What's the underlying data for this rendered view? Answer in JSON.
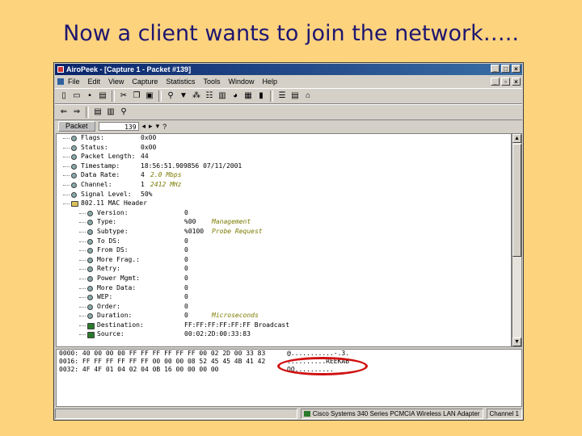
{
  "slide": {
    "title": "Now a client wants to join the network….."
  },
  "window": {
    "title": "AiroPeek - [Capture 1 - Packet #139]",
    "menu": [
      "File",
      "Edit",
      "View",
      "Capture",
      "Statistics",
      "Tools",
      "Window",
      "Help"
    ]
  },
  "navigator": {
    "label": "Packet",
    "value": "139"
  },
  "decode_rows": [
    {
      "name": "Flags:",
      "value": "0x00",
      "comment": "",
      "level": 0,
      "icon": "field"
    },
    {
      "name": "Status:",
      "value": "0x00",
      "comment": "",
      "level": 0,
      "icon": "field"
    },
    {
      "name": "Packet Length:",
      "value": "44",
      "comment": "",
      "level": 0,
      "icon": "field"
    },
    {
      "name": "Timestamp:",
      "value": "18:56:51.909856 07/11/2001",
      "comment": "",
      "level": 0,
      "icon": "field"
    },
    {
      "name": "Data Rate:",
      "value": "4",
      "comment": "2.0 Mbps",
      "level": 0,
      "icon": "field"
    },
    {
      "name": "Channel:",
      "value": "1",
      "comment": "2412 MHz",
      "level": 0,
      "icon": "field"
    },
    {
      "name": "Signal Level:",
      "value": "50%",
      "comment": "",
      "level": 0,
      "icon": "field"
    },
    {
      "name": "802.11 MAC Header",
      "value": "",
      "comment": "",
      "level": 0,
      "icon": "folder"
    },
    {
      "name": "Version:",
      "value": "0",
      "comment": "",
      "level": 1,
      "icon": "field"
    },
    {
      "name": "Type:",
      "value": "%00",
      "comment": "Management",
      "level": 1,
      "icon": "field"
    },
    {
      "name": "Subtype:",
      "value": "%0100",
      "comment": "Probe Request",
      "level": 1,
      "icon": "field"
    },
    {
      "name": "To DS:",
      "value": "0",
      "comment": "",
      "level": 1,
      "icon": "field"
    },
    {
      "name": "From DS:",
      "value": "0",
      "comment": "",
      "level": 1,
      "icon": "field"
    },
    {
      "name": "More Frag.:",
      "value": "0",
      "comment": "",
      "level": 1,
      "icon": "field"
    },
    {
      "name": "Retry:",
      "value": "0",
      "comment": "",
      "level": 1,
      "icon": "field"
    },
    {
      "name": "Power Mgmt:",
      "value": "0",
      "comment": "",
      "level": 1,
      "icon": "field"
    },
    {
      "name": "More Data:",
      "value": "0",
      "comment": "",
      "level": 1,
      "icon": "field"
    },
    {
      "name": "WEP:",
      "value": "0",
      "comment": "",
      "level": 1,
      "icon": "field"
    },
    {
      "name": "Order:",
      "value": "0",
      "comment": "",
      "level": 1,
      "icon": "field"
    },
    {
      "name": "Duration:",
      "value": "0",
      "comment": "Microseconds",
      "level": 1,
      "icon": "field"
    },
    {
      "name": "Destination:",
      "value": "FF:FF:FF:FF:FF:FF  Broadcast",
      "comment": "",
      "level": 1,
      "icon": "node"
    },
    {
      "name": "Source:",
      "value": "00:02:2D:00:33:83",
      "comment": "",
      "level": 1,
      "icon": "node"
    }
  ],
  "hex_rows": [
    {
      "offset": "0000:",
      "bytes": "40 00 00 00 FF FF FF FF FF FF 00 02 2D 00 33 83",
      "ascii": "@...........-.3."
    },
    {
      "offset": "0016:",
      "bytes": "FF FF FF FF FF FF 00 00 00 08 52 45 45 4B 41 42",
      "ascii": "..........REEKAB"
    },
    {
      "offset": "0032:",
      "bytes": "4F 4F 01 04 02 04 0B 16 00 00 00 00",
      "ascii": "OO.........."
    }
  ],
  "status": {
    "adapter": "Cisco Systems 340 Series PCMCIA Wireless LAN Adapter",
    "channel": "Channel 1"
  },
  "colors": {
    "slide_bg": "#fdd37e",
    "title": "#1e1670",
    "highlight": "#d01010",
    "comment": "#7a7a00"
  }
}
